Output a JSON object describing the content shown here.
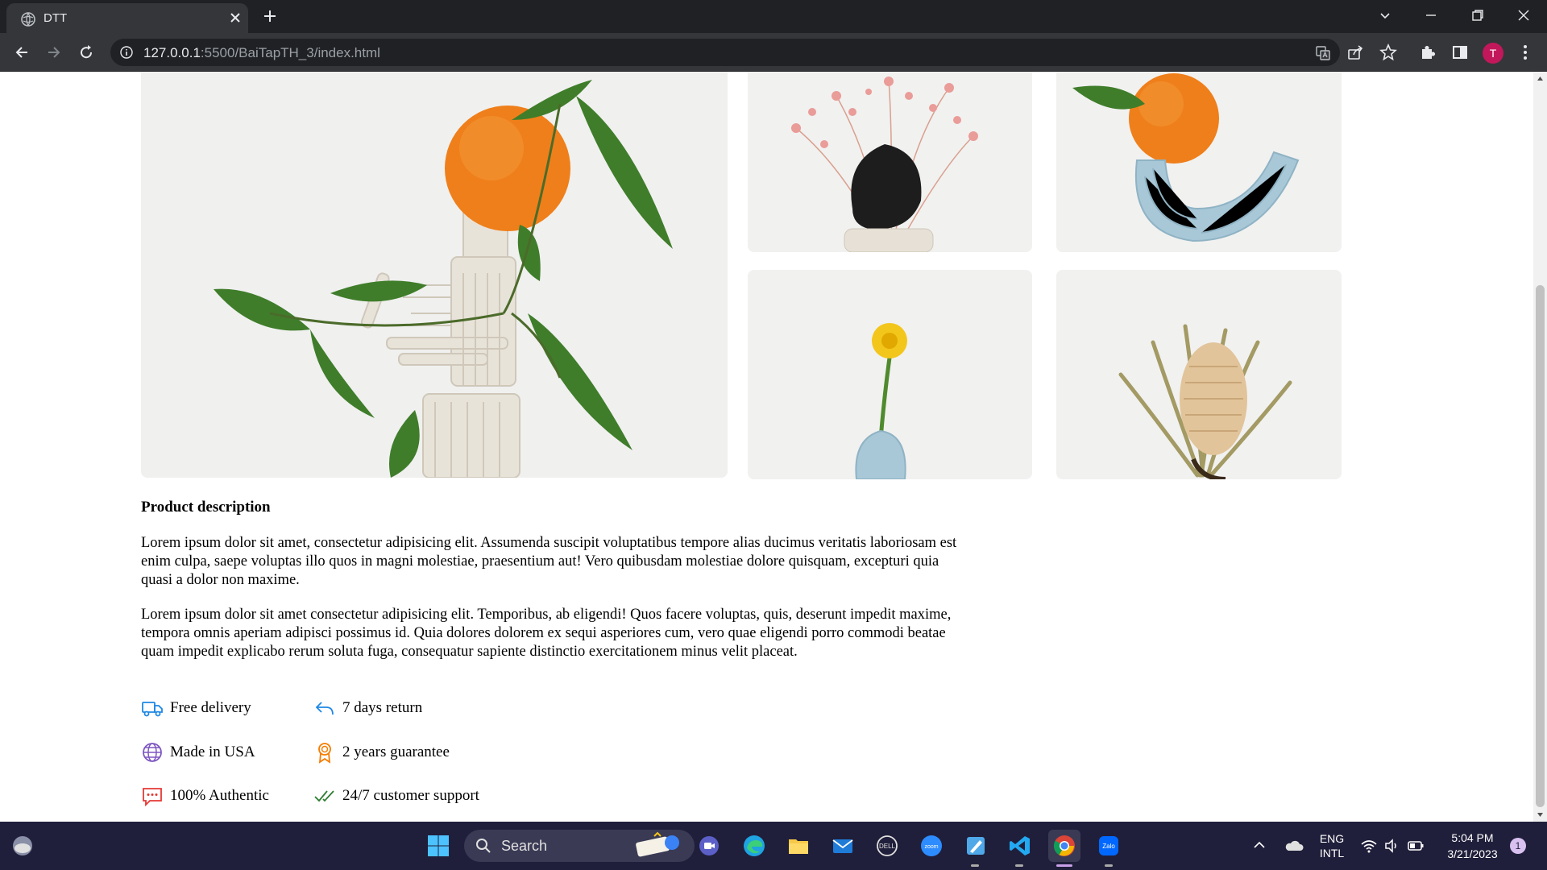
{
  "browser": {
    "tab_title": "DTT",
    "url_host": "127.0.0.1",
    "url_path": ":5500/BaiTapTH_3/index.html",
    "avatar_letter": "T"
  },
  "product": {
    "description_title": "Product description",
    "paragraphs": [
      "Lorem ipsum dolor sit amet, consectetur adipisicing elit. Assumenda suscipit voluptatibus tempore alias ducimus veritatis laboriosam est enim culpa, saepe voluptas illo quos in magni molestiae, praesentium aut! Vero quibusdam molestiae dolore quisquam, excepturi quia quasi a dolor non maxime.",
      "Lorem ipsum dolor sit amet consectetur adipisicing elit. Temporibus, ab eligendi! Quos facere voluptas, quis, deserunt impedit maxime, tempora omnis aperiam adipisci possimus id. Quia dolores dolorem ex sequi asperiores cum, vero quae eligendi porro commodi beatae quam impedit explicabo rerum soluta fuga, consequatur sapiente distinctio exercitationem minus velit placeat."
    ],
    "features": [
      {
        "label": "Free delivery",
        "icon": "truck-icon",
        "color": "#1e88e5"
      },
      {
        "label": "7 days return",
        "icon": "return-arrow-icon",
        "color": "#1e88e5"
      },
      {
        "label": "Made in USA",
        "icon": "globe-icon",
        "color": "#7e57c2"
      },
      {
        "label": "2 years guarantee",
        "icon": "award-icon",
        "color": "#f57c00"
      },
      {
        "label": "100% Authentic",
        "icon": "message-icon",
        "color": "#e53935"
      },
      {
        "label": "24/7 customer support",
        "icon": "double-check-icon",
        "color": "#2e7d32"
      }
    ]
  },
  "taskbar": {
    "search_label": "Search",
    "lang_top": "ENG",
    "lang_bottom": "INTL",
    "time": "5:04 PM",
    "date": "3/21/2023",
    "notification_count": "1"
  }
}
